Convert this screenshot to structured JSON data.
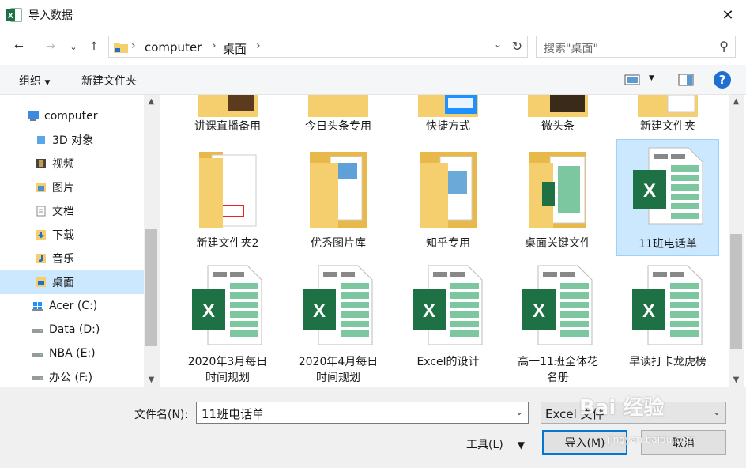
{
  "window": {
    "title": "导入数据"
  },
  "address": {
    "crumbs": [
      "computer",
      "桌面"
    ]
  },
  "search": {
    "placeholder": "搜索\"桌面\""
  },
  "toolbar": {
    "organize": "组织",
    "new_folder": "新建文件夹"
  },
  "sidebar": {
    "items": [
      {
        "label": "computer",
        "icon": "computer-icon"
      },
      {
        "label": "3D 对象",
        "icon": "3d-objects-icon"
      },
      {
        "label": "视频",
        "icon": "video-icon"
      },
      {
        "label": "图片",
        "icon": "pictures-icon"
      },
      {
        "label": "文档",
        "icon": "documents-icon"
      },
      {
        "label": "下载",
        "icon": "download-icon"
      },
      {
        "label": "音乐",
        "icon": "music-icon"
      },
      {
        "label": "桌面",
        "icon": "desktop-icon"
      },
      {
        "label": "Acer (C:)",
        "icon": "windows-drive-icon"
      },
      {
        "label": "Data (D:)",
        "icon": "drive-icon"
      },
      {
        "label": "NBA (E:)",
        "icon": "drive-icon"
      },
      {
        "label": "办公 (F:)",
        "icon": "drive-icon"
      }
    ]
  },
  "files": {
    "row1": [
      "讲课直播备用",
      "今日头条专用",
      "快捷方式",
      "微头条",
      "新建文件夹"
    ],
    "row2": [
      "新建文件夹2",
      "优秀图片库",
      "知乎专用",
      "桌面关键文件",
      "11班电话单"
    ],
    "row3": [
      {
        "l1": "2020年3月每日",
        "l2": "时间规划"
      },
      {
        "l1": "2020年4月每日",
        "l2": "时间规划"
      },
      {
        "l1": "Excel的设计",
        "l2": ""
      },
      {
        "l1": "高一11班全体花",
        "l2": "名册"
      },
      {
        "l1": "早读打卡龙虎榜",
        "l2": ""
      }
    ]
  },
  "footer": {
    "filename_label": "文件名(N):",
    "filename_value": "11班电话单",
    "filetype_value": "Excel 文件",
    "tools_label": "工具(L)",
    "import_label": "导入(M)",
    "cancel_label": "取消"
  },
  "watermark": {
    "text": "Bai 经验",
    "sub": "jingyan.baidu.com"
  },
  "colors": {
    "excel_green": "#1e7145",
    "folder_yellow": "#f5cf6e",
    "selection": "#cce8ff",
    "accent": "#0078d7"
  }
}
